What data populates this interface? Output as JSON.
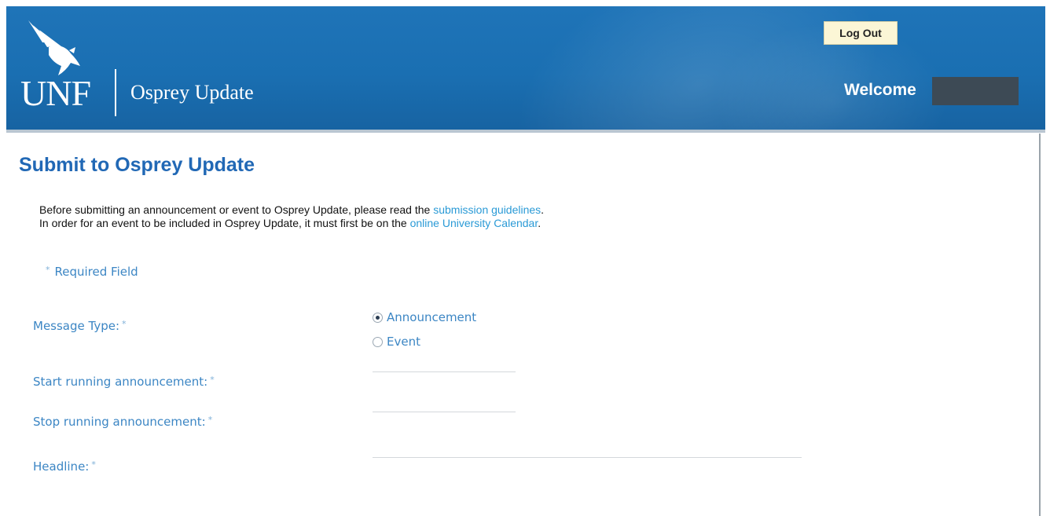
{
  "header": {
    "logo_text": "UNF",
    "site_name": "Osprey Update",
    "logout_label": "Log Out",
    "welcome_text": "Welcome"
  },
  "main": {
    "title": "Submit to Osprey Update",
    "intro": {
      "line1_text": "Before submitting an announcement or event to Osprey Update, please read the ",
      "line1_link": "submission guidelines",
      "line1_end": ".",
      "line2_text": "In order for an event to be included in Osprey Update, it must first be on the ",
      "line2_link": "online University Calendar",
      "line2_end": "."
    },
    "required_note": "Required Field",
    "required_marker": "*"
  },
  "form": {
    "message_type": {
      "label": "Message Type:",
      "options": [
        {
          "label": "Announcement",
          "selected": true
        },
        {
          "label": "Event",
          "selected": false
        }
      ]
    },
    "start_label": "Start running announcement:",
    "stop_label": "Stop running announcement:",
    "headline_label": "Headline:",
    "start_value": "",
    "stop_value": "",
    "headline_value": ""
  },
  "colors": {
    "header_blue": "#1a6fb2",
    "title_blue": "#2168b5",
    "link_blue": "#2a9ad6",
    "label_blue": "#3c86c4",
    "logout_bg": "#fbf6d6"
  }
}
